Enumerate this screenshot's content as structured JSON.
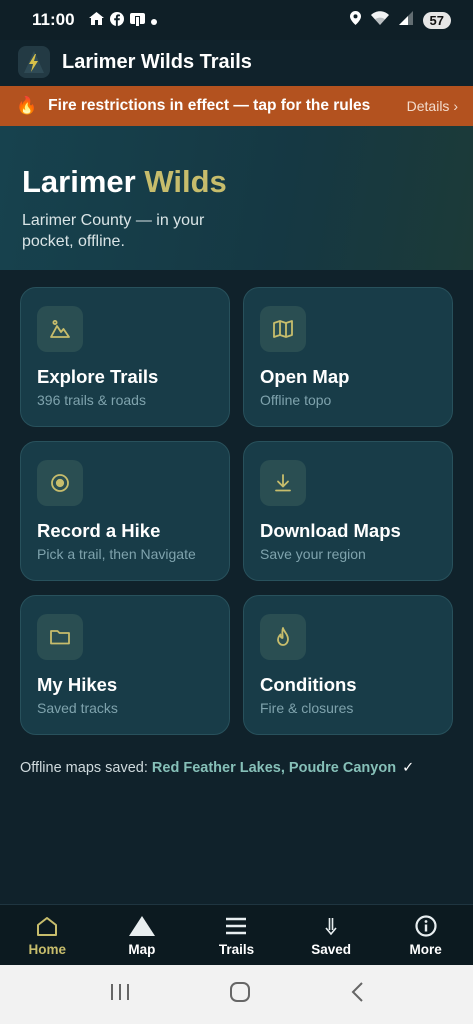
{
  "status_bar": {
    "time": "11:00",
    "battery": "57",
    "icons_left": [
      "home-icon",
      "facebook-icon",
      "wallet-icon",
      "dot-icon"
    ],
    "icons_right": [
      "location-icon",
      "wifi-icon",
      "signal-icon",
      "battery-icon"
    ]
  },
  "app_bar": {
    "title": "Larimer Wilds Trails",
    "logo_icon": "mountain-bolt-icon"
  },
  "fire_banner": {
    "emoji": "🔥",
    "text": "Fire restrictions in effect — tap for the rules",
    "details": "Details ›",
    "color": "#b3521f"
  },
  "hero": {
    "title_main": "Larimer",
    "title_accent": "Wilds",
    "subtitle": "Larimer County — in your pocket, offline.",
    "accent_color": "#c7bd6c"
  },
  "tiles": [
    {
      "title": "Explore Trails",
      "subtitle": "396 trails & roads",
      "icon": "mountain-icon"
    },
    {
      "title": "Open Map",
      "subtitle": "Offline topo",
      "icon": "map-icon"
    },
    {
      "title": "Record a Hike",
      "subtitle": "Pick a trail, then Navigate",
      "icon": "record-icon"
    },
    {
      "title": "Download Maps",
      "subtitle": "Save your region",
      "icon": "download-icon"
    },
    {
      "title": "My Hikes",
      "subtitle": "Saved tracks",
      "icon": "folder-icon"
    },
    {
      "title": "Conditions",
      "subtitle": "Fire & closures",
      "icon": "flame-icon"
    }
  ],
  "offline": {
    "label": "Offline maps saved: ",
    "regions": "Red Feather Lakes, Poudre Canyon",
    "check": "✓"
  },
  "bottom_nav": [
    {
      "label": "Home",
      "icon": "home-icon",
      "active": true
    },
    {
      "label": "Map",
      "icon": "triangle-icon",
      "active": false
    },
    {
      "label": "Trails",
      "icon": "list-icon",
      "active": false
    },
    {
      "label": "Saved",
      "icon": "arrow-down-icon",
      "active": false
    },
    {
      "label": "More",
      "icon": "info-icon",
      "active": false
    }
  ],
  "system_nav": [
    "recent-apps-icon",
    "home-button-icon",
    "back-icon"
  ]
}
